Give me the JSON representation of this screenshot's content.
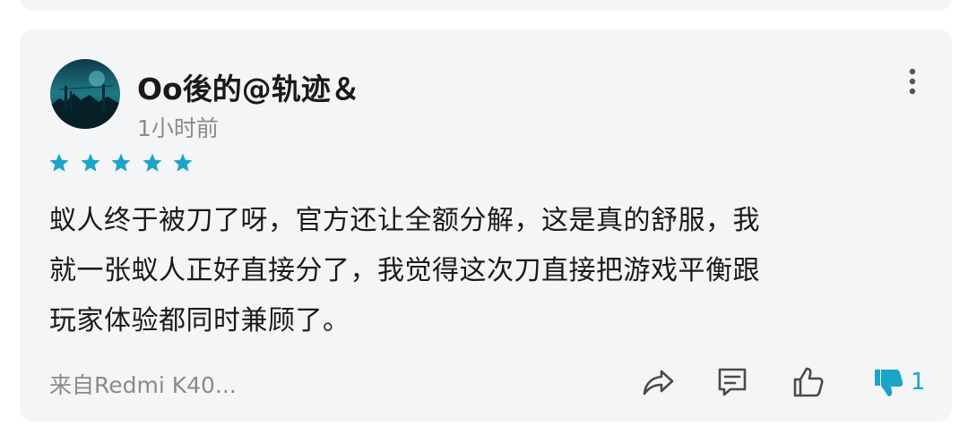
{
  "review": {
    "username": "Oo後的@轨迹＆",
    "time": "1小时前",
    "rating": 5,
    "content_lines": [
      "蚁人终于被刀了呀，官方还让全额分解，这是真的舒服，我",
      "就一张蚁人正好直接分了，我觉得这次刀直接把游戏平衡跟",
      "玩家体验都同时兼顾了。"
    ],
    "device": "来自Redmi K40...",
    "actions": {
      "share_icon": "share-icon",
      "comment_icon": "comment-icon",
      "like_icon": "thumbs-up-icon",
      "dislike_icon": "thumbs-down-icon",
      "dislike_count": "1"
    }
  },
  "colors": {
    "accent": "#1aa4c8",
    "card_bg": "#f4f5f7",
    "secondary_text": "#8a8a8a"
  }
}
